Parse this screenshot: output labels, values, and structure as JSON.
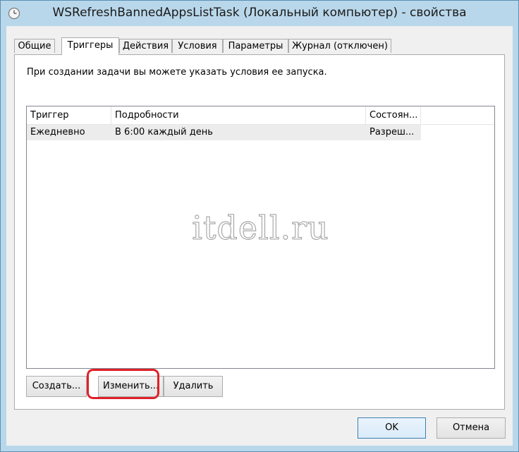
{
  "window": {
    "title": "WSRefreshBannedAppsListTask (Локальный компьютер) - свойства",
    "icon": "clock-icon"
  },
  "tabs": [
    {
      "label": "Общие",
      "active": false
    },
    {
      "label": "Триггеры",
      "active": true
    },
    {
      "label": "Действия",
      "active": false
    },
    {
      "label": "Условия",
      "active": false
    },
    {
      "label": "Параметры",
      "active": false
    },
    {
      "label": "Журнал (отключен)",
      "active": false
    }
  ],
  "triggers_panel": {
    "intro_text": "При создании задачи вы можете указать условия ее запуска.",
    "columns": [
      "Триггер",
      "Подробности",
      "Состоян..."
    ],
    "rows": [
      {
        "trigger": "Ежедневно",
        "details": "В 6:00 каждый день",
        "status": "Разреш..."
      }
    ],
    "watermark": "itdell.ru",
    "buttons": {
      "create": "Создать...",
      "edit": "Изменить...",
      "delete": "Удалить"
    }
  },
  "dialog_buttons": {
    "ok": "OK",
    "cancel": "Отмена"
  },
  "colors": {
    "title_bar": "#b9d7ea",
    "highlight_annotation": "#e0202a",
    "selected_row": "#ececec"
  }
}
